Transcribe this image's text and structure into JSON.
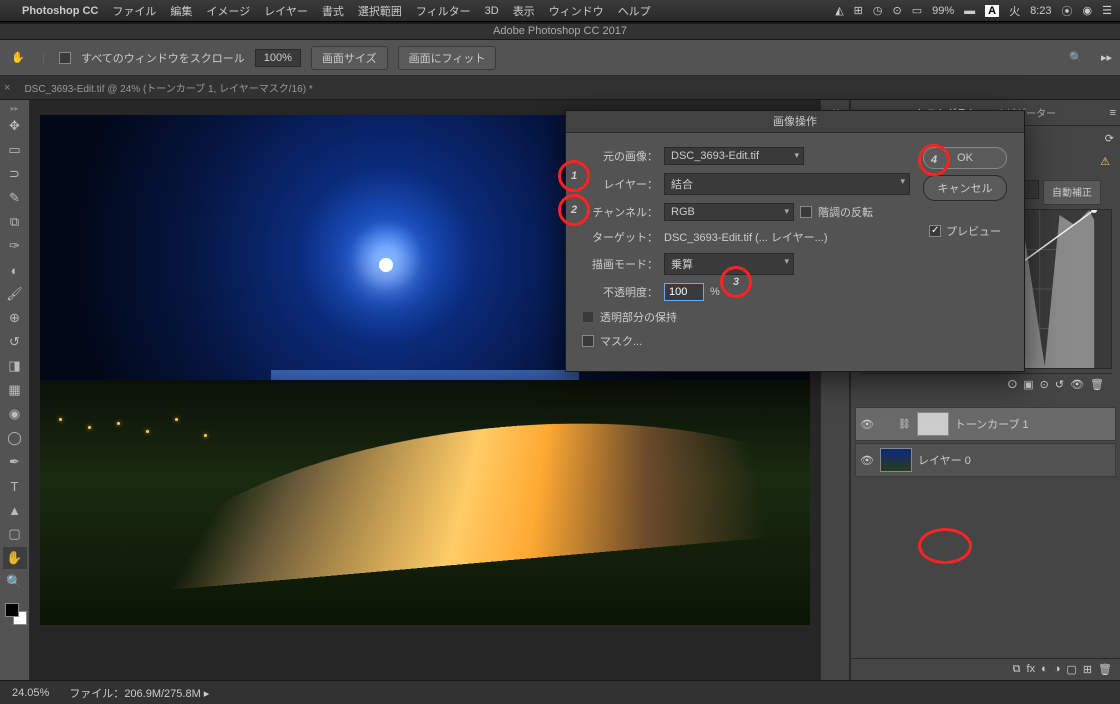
{
  "menubar": {
    "app": "Photoshop CC",
    "items": [
      "ファイル",
      "編集",
      "イメージ",
      "レイヤー",
      "書式",
      "選択範囲",
      "フィルター",
      "3D",
      "表示",
      "ウィンドウ",
      "ヘルプ"
    ],
    "battery": "99%",
    "lang": "A",
    "day": "火",
    "time": "8:23"
  },
  "window": {
    "title": "Adobe Photoshop CC 2017"
  },
  "optionsbar": {
    "scroll_all": "すべてのウィンドウをスクロール",
    "zoom_value": "100%",
    "fit_screen": "画面サイズ",
    "fit_page": "画面にフィット"
  },
  "document_tab": "DSC_3693-Edit.tif @ 24% (トーンカーブ 1, レイヤーマスク/16) *",
  "dialog": {
    "title": "画像操作",
    "source_label": "元の画像：",
    "source_value": "DSC_3693-Edit.tif",
    "layer_label": "レイヤー：",
    "layer_value": "結合",
    "channel_label": "チャンネル：",
    "channel_value": "RGB",
    "invert_label": "階調の反転",
    "target_label": "ターゲット：",
    "target_value": "DSC_3693-Edit.tif (... レイヤー...)",
    "blend_label": "描画モード：",
    "blend_value": "乗算",
    "opacity_label": "不透明度：",
    "opacity_value": "100",
    "opacity_unit": "%",
    "preserve_trans": "透明部分の保持",
    "mask_label": "マスク...",
    "ok": "OK",
    "cancel": "キャンセル",
    "preview": "プレビュー"
  },
  "panels": {
    "tab_histogram": "ヒストグラム",
    "tab_navigator": "ナビゲーター",
    "curves_preset": "",
    "auto": "自動補正"
  },
  "layers": {
    "item1": "トーンカーブ 1",
    "item2": "レイヤー 0"
  },
  "statusbar": {
    "zoom": "24.05%",
    "file": "ファイル：",
    "file_size": "206.9M/275.8M"
  },
  "annotations": {
    "a1": "1",
    "a2": "2",
    "a3": "3",
    "a4": "4"
  }
}
